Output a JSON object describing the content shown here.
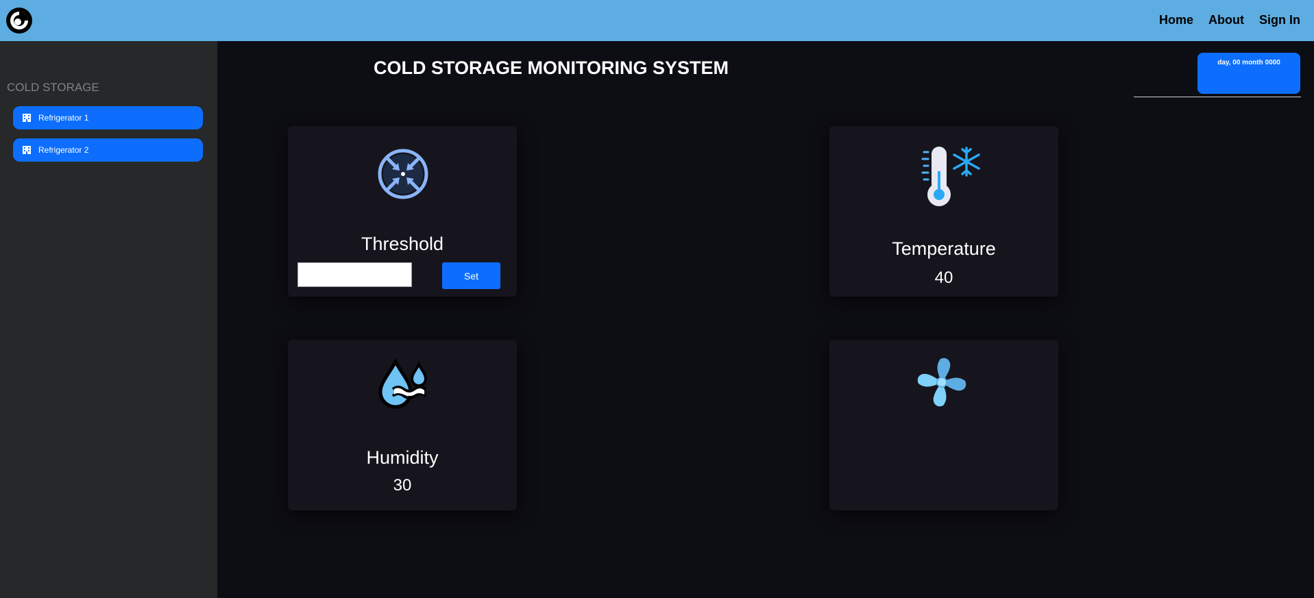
{
  "nav": {
    "home": "Home",
    "about": "About",
    "sign_in": "Sign In"
  },
  "logo": {
    "icon": "logo-ring-icon"
  },
  "sidebar": {
    "title": "COLD STORAGE",
    "items": [
      {
        "label": "Refrigerator 1",
        "icon": "building-icon"
      },
      {
        "label": "Refrigerator 2",
        "icon": "building-icon"
      }
    ]
  },
  "header": {
    "title": "COLD STORAGE MONITORING SYSTEM",
    "date": "day, 00 month 0000"
  },
  "cards": {
    "threshold": {
      "label": "Threshold",
      "icon": "compress-arrows-icon",
      "input_value": "",
      "button_label": "Set"
    },
    "temperature": {
      "label": "Temperature",
      "value": "40",
      "icon": "thermometer-snowflake-icon"
    },
    "humidity": {
      "label": "Humidity",
      "value": "30",
      "icon": "water-drops-icon"
    },
    "fan": {
      "icon": "fan-icon"
    }
  },
  "colors": {
    "topbar": "#5dade2",
    "accent": "#0d6efd",
    "background": "#0d0d14",
    "sidebar": "#272829",
    "card": "#16151d"
  }
}
